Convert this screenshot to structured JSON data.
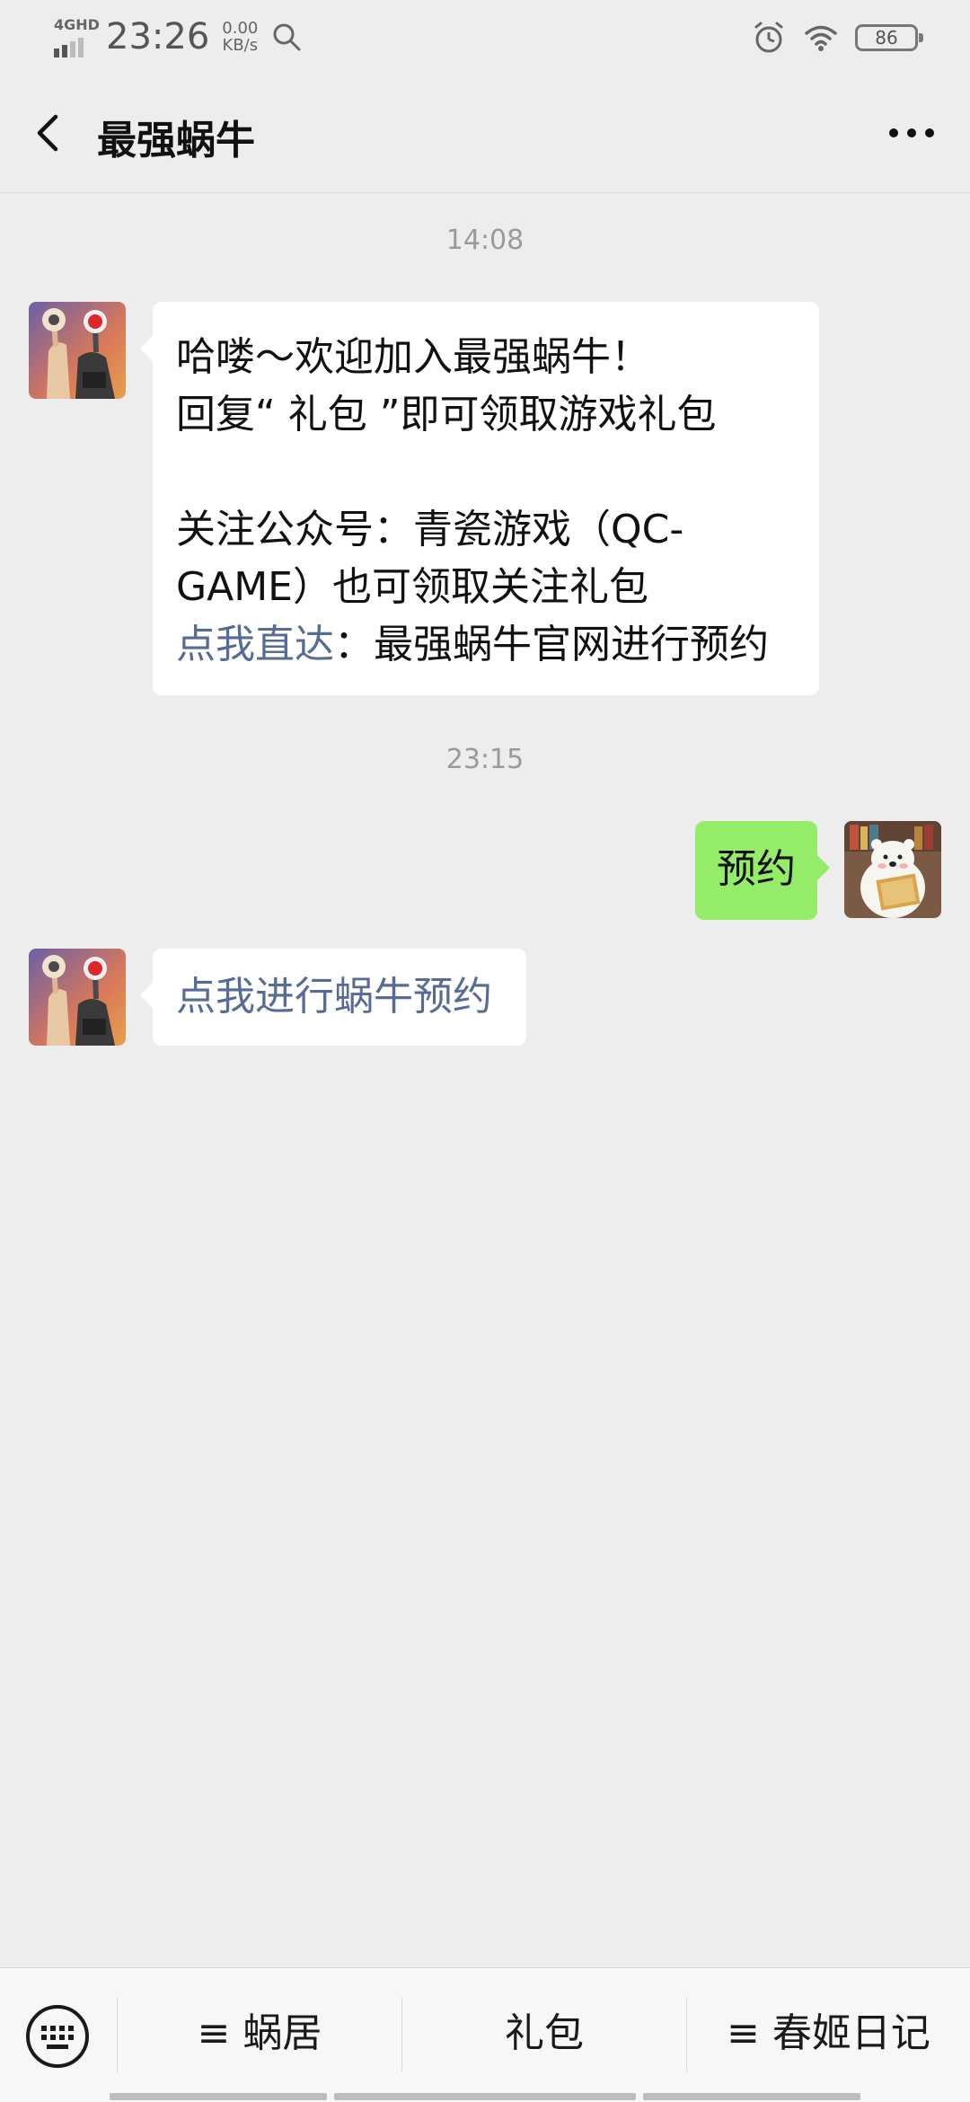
{
  "status_bar": {
    "network": "4GHD",
    "time": "23:26",
    "speed_value": "0.00",
    "speed_unit": "KB/s",
    "battery": "86"
  },
  "header": {
    "title": "最强蜗牛"
  },
  "chat": {
    "timestamp_1": "14:08",
    "msg1": {
      "line1": "哈喽～欢迎加入最强蜗牛！",
      "line2": "回复“ 礼包 ”即可领取游戏礼包",
      "line3": "关注公众号：青瓷游戏（QC-",
      "line4": "GAME）也可领取关注礼包",
      "link_text": "点我直达",
      "line5_rest": "：最强蜗牛官网进行预约"
    },
    "timestamp_2": "23:15",
    "msg2_out": "预约",
    "msg3_link": "点我进行蜗牛预约"
  },
  "bottom_menu": {
    "items": [
      "≡ 蜗居",
      "礼包",
      "≡ 春姬日记"
    ]
  },
  "colors": {
    "background": "#ededed",
    "bubble_in": "#ffffff",
    "bubble_out": "#95ec69",
    "link": "#576b95"
  }
}
